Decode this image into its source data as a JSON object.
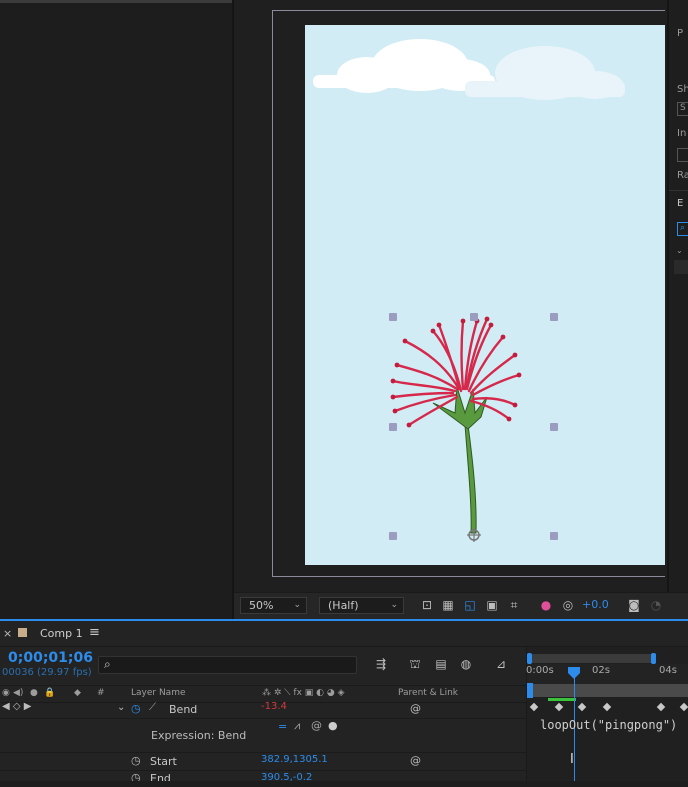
{
  "viewer": {
    "zoom": "50%",
    "resolution": "(Half)",
    "exposure": "+0.0"
  },
  "right_panel": {
    "labels": [
      "P",
      "Sh",
      "S",
      "In",
      "Ra",
      "E"
    ]
  },
  "timeline": {
    "tab": {
      "close": "×",
      "label": "Comp 1",
      "menu": "≡"
    },
    "timecode": "0;00;01;06",
    "frame_info": "00036 (29.97 fps)",
    "search": {
      "placeholder": "",
      "icon": "search-icon"
    },
    "columns": {
      "layer_name": "Layer Name",
      "parent_link": "Parent & Link",
      "number": "#"
    },
    "rows": [
      {
        "name": "Bend",
        "value": "-13.4",
        "value_color": "red"
      },
      {
        "name": "Expression: Bend",
        "value": ""
      },
      {
        "name": "Start",
        "value": "382.9,1305.1"
      },
      {
        "name": "End",
        "value": "390.5,-0.2"
      }
    ],
    "ruler": {
      "labels": [
        "0:00s",
        "02s",
        "04s"
      ]
    },
    "expression": "loopOut(\"pingpong\")",
    "cursor": "I"
  },
  "colors": {
    "accent": "#2d8ceb",
    "sky": "#d2ecf5",
    "flower": "#d6284a",
    "stem": "#5a9a3e",
    "comp_swatch": "#c7ad89"
  }
}
